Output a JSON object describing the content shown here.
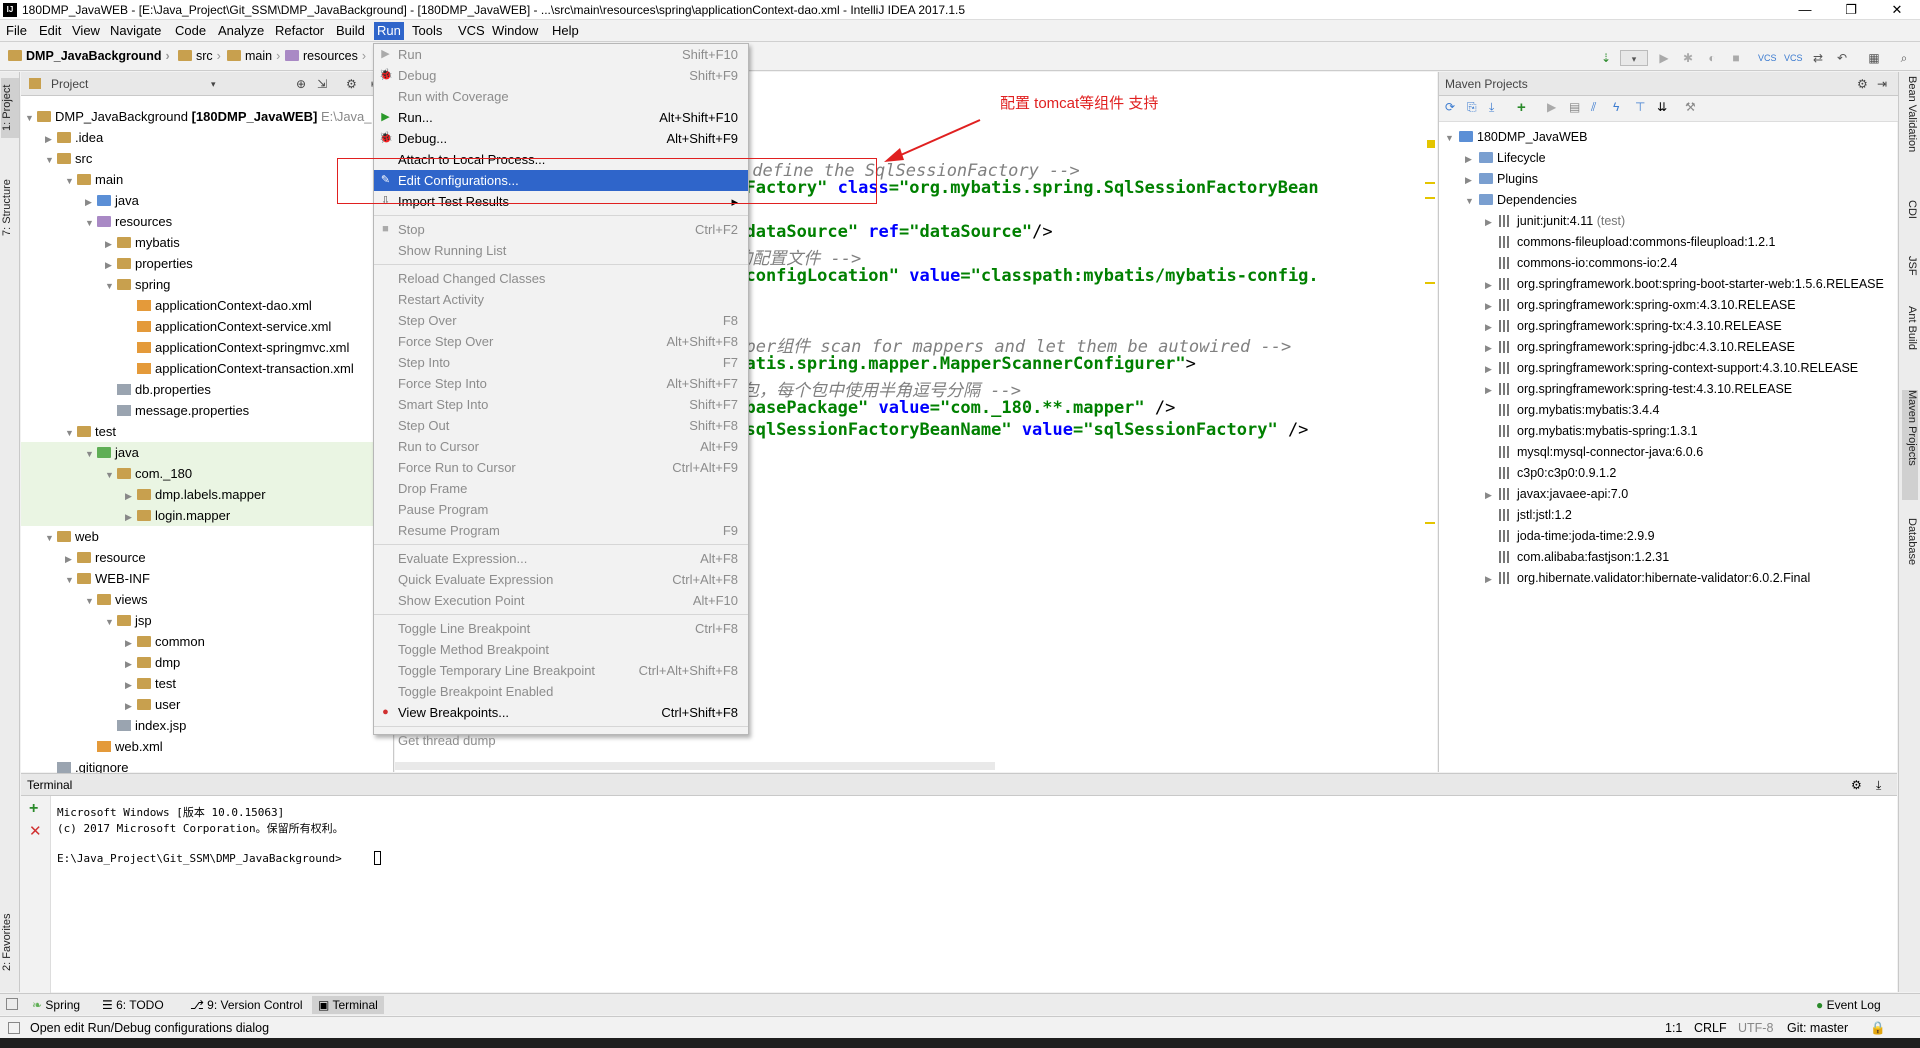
{
  "window": {
    "title": "180DMP_JavaWEB - [E:\\Java_Project\\Git_SSM\\DMP_JavaBackground] - [180DMP_JavaWEB] - ...\\src\\main\\resources\\spring\\applicationContext-dao.xml - IntelliJ IDEA 2017.1.5",
    "min": "—",
    "max": "❐",
    "close": "✕"
  },
  "menubar": [
    "File",
    "Edit",
    "View",
    "Navigate",
    "Code",
    "Analyze",
    "Refactor",
    "Build",
    "Run",
    "Tools",
    "VCS",
    "Window",
    "Help"
  ],
  "breadcrumb": [
    "DMP_JavaBackground",
    "src",
    "main",
    "resources"
  ],
  "project_panel": {
    "title": "Project",
    "root": "DMP_JavaBackground",
    "root_module": "[180DMP_JavaWEB]",
    "root_path": "E:\\Java_",
    "tree": [
      {
        "label": ".idea",
        "depth": 1,
        "icon": "folder",
        "arrow": "▶"
      },
      {
        "label": "src",
        "depth": 1,
        "icon": "folder",
        "arrow": "▼"
      },
      {
        "label": "main",
        "depth": 2,
        "icon": "folder",
        "arrow": "▼"
      },
      {
        "label": "java",
        "depth": 3,
        "icon": "src",
        "arrow": "▶"
      },
      {
        "label": "resources",
        "depth": 3,
        "icon": "res",
        "arrow": "▼"
      },
      {
        "label": "mybatis",
        "depth": 4,
        "icon": "folder",
        "arrow": "▶"
      },
      {
        "label": "properties",
        "depth": 4,
        "icon": "folder",
        "arrow": "▶"
      },
      {
        "label": "spring",
        "depth": 4,
        "icon": "folder",
        "arrow": "▼"
      },
      {
        "label": "applicationContext-dao.xml",
        "depth": 5,
        "icon": "xml",
        "arrow": ""
      },
      {
        "label": "applicationContext-service.xml",
        "depth": 5,
        "icon": "xml",
        "arrow": ""
      },
      {
        "label": "applicationContext-springmvc.xml",
        "depth": 5,
        "icon": "xml",
        "arrow": ""
      },
      {
        "label": "applicationContext-transaction.xml",
        "depth": 5,
        "icon": "xml",
        "arrow": ""
      },
      {
        "label": "db.properties",
        "depth": 4,
        "icon": "file",
        "arrow": ""
      },
      {
        "label": "message.properties",
        "depth": 4,
        "icon": "file",
        "arrow": ""
      },
      {
        "label": "test",
        "depth": 2,
        "icon": "folder",
        "arrow": "▼"
      },
      {
        "label": "java",
        "depth": 3,
        "icon": "test",
        "arrow": "▼",
        "hl": true
      },
      {
        "label": "com._180",
        "depth": 4,
        "icon": "folder",
        "arrow": "▼",
        "hl": true
      },
      {
        "label": "dmp.labels.mapper",
        "depth": 5,
        "icon": "folder",
        "arrow": "▶",
        "hl": true
      },
      {
        "label": "login.mapper",
        "depth": 5,
        "icon": "folder",
        "arrow": "▶",
        "hl": true
      },
      {
        "label": "web",
        "depth": 1,
        "icon": "folder",
        "arrow": "▼"
      },
      {
        "label": "resource",
        "depth": 2,
        "icon": "folder",
        "arrow": "▶"
      },
      {
        "label": "WEB-INF",
        "depth": 2,
        "icon": "folder",
        "arrow": "▼"
      },
      {
        "label": "views",
        "depth": 3,
        "icon": "folder",
        "arrow": "▼"
      },
      {
        "label": "jsp",
        "depth": 4,
        "icon": "folder",
        "arrow": "▼"
      },
      {
        "label": "common",
        "depth": 5,
        "icon": "folder",
        "arrow": "▶"
      },
      {
        "label": "dmp",
        "depth": 5,
        "icon": "folder",
        "arrow": "▶"
      },
      {
        "label": "test",
        "depth": 5,
        "icon": "folder",
        "arrow": "▶"
      },
      {
        "label": "user",
        "depth": 5,
        "icon": "folder",
        "arrow": "▶"
      },
      {
        "label": "index.jsp",
        "depth": 4,
        "icon": "file",
        "arrow": ""
      },
      {
        "label": "web.xml",
        "depth": 3,
        "icon": "xml",
        "arrow": ""
      },
      {
        "label": ".gitignore",
        "depth": 1,
        "icon": "file",
        "arrow": ""
      }
    ]
  },
  "editor": {
    "lines": [
      [
        {
          "t": "置 define the SqlSessionFactory -->",
          "c": "cm"
        }
      ],
      [
        {
          "t": "onFactory\" ",
          "c": "st"
        },
        {
          "t": "class",
          "c": "at"
        },
        {
          "t": "=\"org.mybatis.spring.SqlSessionFactoryBean",
          "c": "st"
        }
      ],
      [
        {
          "t": "",
          "c": ""
        }
      ],
      [
        {
          "t": "=\"dataSource\" ",
          "c": "st"
        },
        {
          "t": "ref",
          "c": "at"
        },
        {
          "t": "=\"dataSource\"",
          "c": "st"
        },
        {
          "t": "/>",
          "c": ""
        }
      ],
      [
        {
          "t": "s的配置文件 -->",
          "c": "cm"
        }
      ],
      [
        {
          "t": "=\"configLocation\" ",
          "c": "st"
        },
        {
          "t": "value",
          "c": "at"
        },
        {
          "t": "=\"classpath:mybatis/mybatis-config.",
          "c": "st"
        }
      ],
      [
        {
          "t": "",
          "c": ""
        }
      ],
      [
        {
          "t": "",
          "c": ""
        }
      ],
      [
        {
          "t": "apper组件 scan for mappers and let them be autowired -->",
          "c": "cm"
        }
      ],
      [
        {
          "t": "ybatis.spring.mapper.MapperScannerConfigurer\"",
          "c": "st"
        },
        {
          "t": ">",
          "c": ""
        }
      ],
      [
        {
          "t": "个包，每个包中使用半角逗号分隔 -->",
          "c": "cm"
        }
      ],
      [
        {
          "t": "=\"basePackage\" ",
          "c": "st"
        },
        {
          "t": "value",
          "c": "at"
        },
        {
          "t": "=\"com._180.**.mapper\" ",
          "c": "st"
        },
        {
          "t": "/>",
          "c": ""
        }
      ],
      [
        {
          "t": "=\"sqlSessionFactoryBeanName\" ",
          "c": "st"
        },
        {
          "t": "value",
          "c": "at"
        },
        {
          "t": "=\"sqlSessionFactory\" ",
          "c": "st"
        },
        {
          "t": "/>",
          "c": ""
        }
      ]
    ]
  },
  "run_menu": [
    {
      "label": "Run",
      "shortcut": "Shift+F10",
      "disabled": true,
      "icon": "▶"
    },
    {
      "label": "Debug",
      "shortcut": "Shift+F9",
      "disabled": true,
      "icon": "🐞"
    },
    {
      "label": "Run with Coverage",
      "shortcut": "",
      "disabled": true,
      "icon": ""
    },
    {
      "label": "Run...",
      "shortcut": "Alt+Shift+F10",
      "disabled": false,
      "icon": "▶"
    },
    {
      "label": "Debug...",
      "shortcut": "Alt+Shift+F9",
      "disabled": false,
      "icon": "🐞"
    },
    {
      "label": "Attach to Local Process...",
      "shortcut": "",
      "disabled": false,
      "icon": ""
    },
    {
      "label": "Edit Configurations...",
      "shortcut": "",
      "disabled": false,
      "selected": true,
      "icon": "✎"
    },
    {
      "label": "Import Test Results",
      "shortcut": "▸",
      "disabled": false,
      "icon": "⇩"
    },
    {
      "sep": true
    },
    {
      "label": "Stop",
      "shortcut": "Ctrl+F2",
      "disabled": true,
      "icon": "■"
    },
    {
      "label": "Show Running List",
      "shortcut": "",
      "disabled": true,
      "icon": ""
    },
    {
      "sep": true
    },
    {
      "label": "Reload Changed Classes",
      "shortcut": "",
      "disabled": true,
      "icon": ""
    },
    {
      "label": "Restart Activity",
      "shortcut": "",
      "disabled": true,
      "icon": ""
    },
    {
      "label": "Step Over",
      "shortcut": "F8",
      "disabled": true,
      "icon": ""
    },
    {
      "label": "Force Step Over",
      "shortcut": "Alt+Shift+F8",
      "disabled": true,
      "icon": ""
    },
    {
      "label": "Step Into",
      "shortcut": "F7",
      "disabled": true,
      "icon": ""
    },
    {
      "label": "Force Step Into",
      "shortcut": "Alt+Shift+F7",
      "disabled": true,
      "icon": ""
    },
    {
      "label": "Smart Step Into",
      "shortcut": "Shift+F7",
      "disabled": true,
      "icon": ""
    },
    {
      "label": "Step Out",
      "shortcut": "Shift+F8",
      "disabled": true,
      "icon": ""
    },
    {
      "label": "Run to Cursor",
      "shortcut": "Alt+F9",
      "disabled": true,
      "icon": ""
    },
    {
      "label": "Force Run to Cursor",
      "shortcut": "Ctrl+Alt+F9",
      "disabled": true,
      "icon": ""
    },
    {
      "label": "Drop Frame",
      "shortcut": "",
      "disabled": true,
      "icon": ""
    },
    {
      "label": "Pause Program",
      "shortcut": "",
      "disabled": true,
      "icon": ""
    },
    {
      "label": "Resume Program",
      "shortcut": "F9",
      "disabled": true,
      "icon": ""
    },
    {
      "sep": true
    },
    {
      "label": "Evaluate Expression...",
      "shortcut": "Alt+F8",
      "disabled": true,
      "icon": ""
    },
    {
      "label": "Quick Evaluate Expression",
      "shortcut": "Ctrl+Alt+F8",
      "disabled": true,
      "icon": ""
    },
    {
      "label": "Show Execution Point",
      "shortcut": "Alt+F10",
      "disabled": true,
      "icon": ""
    },
    {
      "sep": true
    },
    {
      "label": "Toggle Line Breakpoint",
      "shortcut": "Ctrl+F8",
      "disabled": true,
      "icon": ""
    },
    {
      "label": "Toggle Method Breakpoint",
      "shortcut": "",
      "disabled": true,
      "icon": ""
    },
    {
      "label": "Toggle Temporary Line Breakpoint",
      "shortcut": "Ctrl+Alt+Shift+F8",
      "disabled": true,
      "icon": ""
    },
    {
      "label": "Toggle Breakpoint Enabled",
      "shortcut": "",
      "disabled": true,
      "icon": ""
    },
    {
      "label": "View Breakpoints...",
      "shortcut": "Ctrl+Shift+F8",
      "disabled": false,
      "icon": "●"
    },
    {
      "sep": true
    },
    {
      "label": "Get thread dump",
      "shortcut": "",
      "disabled": true,
      "icon": ""
    }
  ],
  "annotation": "配置 tomcat等组件 支持",
  "maven": {
    "title": "Maven Projects",
    "items": [
      {
        "label": "180DMP_JavaWEB",
        "depth": 0,
        "arrow": "▼",
        "type": "module"
      },
      {
        "label": "Lifecycle",
        "depth": 1,
        "arrow": "▶",
        "type": "folder"
      },
      {
        "label": "Plugins",
        "depth": 1,
        "arrow": "▶",
        "type": "folder"
      },
      {
        "label": "Dependencies",
        "depth": 1,
        "arrow": "▼",
        "type": "folder"
      },
      {
        "label": "junit:junit:4.11",
        "suffix": " (test)",
        "depth": 2,
        "arrow": "▶",
        "type": "lib"
      },
      {
        "label": "commons-fileupload:commons-fileupload:1.2.1",
        "depth": 2,
        "arrow": "",
        "type": "lib"
      },
      {
        "label": "commons-io:commons-io:2.4",
        "depth": 2,
        "arrow": "",
        "type": "lib"
      },
      {
        "label": "org.springframework.boot:spring-boot-starter-web:1.5.6.RELEASE",
        "depth": 2,
        "arrow": "▶",
        "type": "lib"
      },
      {
        "label": "org.springframework:spring-oxm:4.3.10.RELEASE",
        "depth": 2,
        "arrow": "▶",
        "type": "lib"
      },
      {
        "label": "org.springframework:spring-tx:4.3.10.RELEASE",
        "depth": 2,
        "arrow": "▶",
        "type": "lib"
      },
      {
        "label": "org.springframework:spring-jdbc:4.3.10.RELEASE",
        "depth": 2,
        "arrow": "▶",
        "type": "lib"
      },
      {
        "label": "org.springframework:spring-context-support:4.3.10.RELEASE",
        "depth": 2,
        "arrow": "▶",
        "type": "lib"
      },
      {
        "label": "org.springframework:spring-test:4.3.10.RELEASE",
        "depth": 2,
        "arrow": "▶",
        "type": "lib"
      },
      {
        "label": "org.mybatis:mybatis:3.4.4",
        "depth": 2,
        "arrow": "",
        "type": "lib"
      },
      {
        "label": "org.mybatis:mybatis-spring:1.3.1",
        "depth": 2,
        "arrow": "",
        "type": "lib"
      },
      {
        "label": "mysql:mysql-connector-java:6.0.6",
        "depth": 2,
        "arrow": "",
        "type": "lib"
      },
      {
        "label": "c3p0:c3p0:0.9.1.2",
        "depth": 2,
        "arrow": "",
        "type": "lib"
      },
      {
        "label": "javax:javaee-api:7.0",
        "depth": 2,
        "arrow": "▶",
        "type": "lib"
      },
      {
        "label": "jstl:jstl:1.2",
        "depth": 2,
        "arrow": "",
        "type": "lib"
      },
      {
        "label": "joda-time:joda-time:2.9.9",
        "depth": 2,
        "arrow": "",
        "type": "lib"
      },
      {
        "label": "com.alibaba:fastjson:1.2.31",
        "depth": 2,
        "arrow": "",
        "type": "lib"
      },
      {
        "label": "org.hibernate.validator:hibernate-validator:6.0.2.Final",
        "depth": 2,
        "arrow": "▶",
        "type": "lib"
      }
    ]
  },
  "terminal": {
    "title": "Terminal",
    "lines": [
      "Microsoft Windows [版本 10.0.15063]",
      "(c) 2017 Microsoft Corporation。保留所有权利。",
      "",
      "E:\\Java_Project\\Git_SSM\\DMP_JavaBackground>"
    ]
  },
  "left_tools": [
    "1: Project",
    "7: Structure",
    "2: Favorites"
  ],
  "right_tools": [
    "Bean Validation",
    "CDI",
    "JSF",
    "Ant Build",
    "Maven Projects",
    "Database"
  ],
  "bottom_tabs": [
    {
      "label": "Spring",
      "active": false
    },
    {
      "label": "6: TODO",
      "active": false
    },
    {
      "label": "9: Version Control",
      "active": false
    },
    {
      "label": "Terminal",
      "active": true
    }
  ],
  "event_log": "Event Log",
  "status": {
    "message": "Open edit Run/Debug configurations dialog",
    "position": "1:1",
    "line_sep": "CRLF",
    "encoding": "UTF-8",
    "git": "Git: master"
  },
  "colors": {
    "accent": "#2f65ca",
    "annotation": "#e02020",
    "string": "#008000",
    "attribute": "#0000ff",
    "comment": "#808080"
  }
}
